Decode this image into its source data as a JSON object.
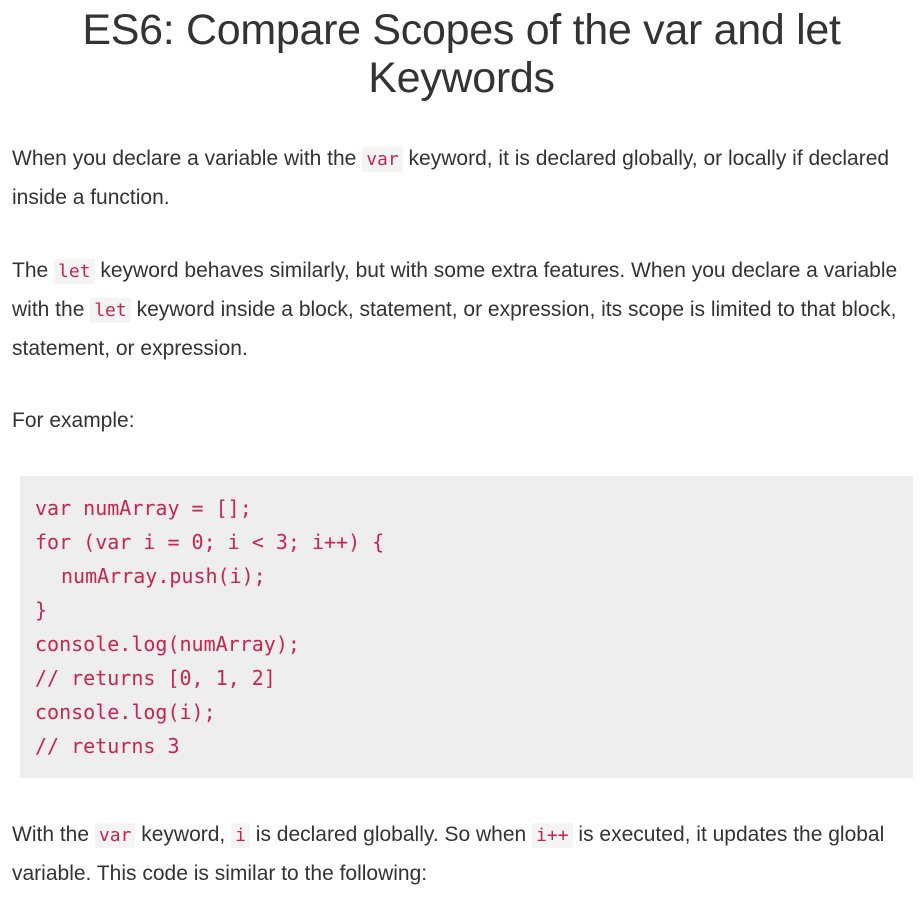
{
  "page": {
    "title": "ES6: Compare Scopes of the var and let Keywords"
  },
  "paragraph1": {
    "t1": "When you declare a variable with the ",
    "c1": "var",
    "t2": " keyword, it is declared globally, or locally if declared inside a function."
  },
  "paragraph2": {
    "t1": "The ",
    "c1": "let",
    "t2": " keyword behaves similarly, but with some extra features. When you declare a variable with the ",
    "c2": "let",
    "t3": " keyword inside a block, statement, or expression, its scope is limited to that block, statement, or expression."
  },
  "paragraph3": {
    "t1": "For example:"
  },
  "code_example": {
    "lines": [
      "var numArray = [];",
      "for (var i = 0; i < 3; i++) {",
      "numArray.push(i);",
      "}",
      "console.log(numArray);",
      "// returns [0, 1, 2]",
      "console.log(i);",
      "// returns 3"
    ]
  },
  "paragraph4": {
    "t1": "With the ",
    "c1": "var",
    "t2": " keyword, ",
    "c2": "i",
    "t3": " is declared globally. So when ",
    "c3": "i++",
    "t4": " is executed, it updates the global variable. This code is similar to the following:"
  },
  "colors": {
    "inline_code_text": "#c7254e",
    "inline_code_bg": "#f4f4f4",
    "code_block_bg": "#eeeeee",
    "body_text": "#333333"
  }
}
